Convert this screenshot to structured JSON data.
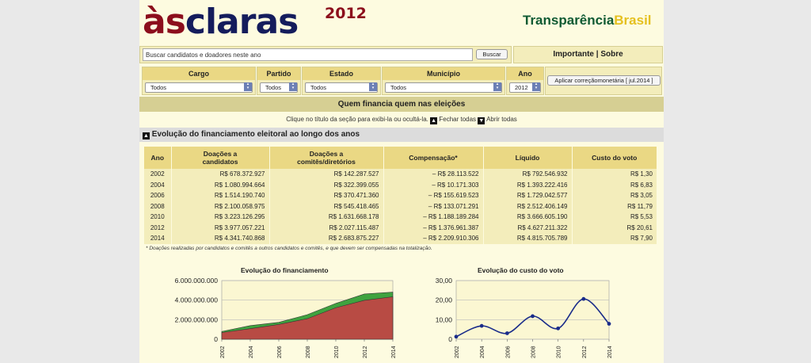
{
  "brand": {
    "part1": "às",
    "part2": "claras",
    "year": "2012"
  },
  "partner": {
    "part1": "Transparência",
    "part2": "Brasil"
  },
  "search": {
    "placeholder": "Buscar candidatos e doadores neste ano",
    "button": "Buscar"
  },
  "top_links": {
    "important": "Importante",
    "sep": " | ",
    "about": "Sobre"
  },
  "filters": [
    {
      "label": "Cargo",
      "value": "Todos"
    },
    {
      "label": "Partido",
      "value": "Todos"
    },
    {
      "label": "Estado",
      "value": "Todos"
    },
    {
      "label": "Município",
      "value": "Todos"
    },
    {
      "label": "Ano",
      "value": "2012"
    }
  ],
  "apply_button": "Aplicar correçãomonetária [ jul.2014 ]",
  "section_header": "Quem financia quem nas eleições",
  "hint": {
    "text": "Clique no título da seção para exibi-la ou ocultá-la.",
    "close_all": "Fechar todas",
    "open_all": "Abrir todas"
  },
  "section_title": "Evolução do financiamento eleitoral ao longo dos anos",
  "table": {
    "headers": [
      "Ano",
      "Doações a\ncandidatos",
      "Doações a\ncomitês/diretórios",
      "Compensação*",
      "Líquido",
      "Custo do voto"
    ],
    "rows": [
      [
        "2002",
        "R$ 678.372.927",
        "R$ 142.287.527",
        "– R$ 28.113.522",
        "R$ 792.546.932",
        "R$ 1,30"
      ],
      [
        "2004",
        "R$ 1.080.994.664",
        "R$ 322.399.055",
        "– R$ 10.171.303",
        "R$ 1.393.222.416",
        "R$ 6,83"
      ],
      [
        "2006",
        "R$ 1.514.190.740",
        "R$ 370.471.360",
        "– R$ 155.619.523",
        "R$ 1.729.042.577",
        "R$ 3,05"
      ],
      [
        "2008",
        "R$ 2.100.058.975",
        "R$ 545.418.465",
        "– R$ 133.071.291",
        "R$ 2.512.406.149",
        "R$ 11,79"
      ],
      [
        "2010",
        "R$ 3.223.126.295",
        "R$ 1.631.668.178",
        "– R$ 1.188.189.284",
        "R$ 3.666.605.190",
        "R$ 5,53"
      ],
      [
        "2012",
        "R$ 3.977.057.221",
        "R$ 2.027.115.487",
        "– R$ 1.376.961.387",
        "R$ 4.627.211.322",
        "R$ 20,61"
      ],
      [
        "2014",
        "R$ 4.341.740.868",
        "R$ 2.683.875.227",
        "– R$ 2.209.910.306",
        "R$ 4.815.705.789",
        "R$ 7,90"
      ]
    ]
  },
  "note": "* Doações realizadas por candidatos e comitês a outros candidatos e comitês, e que devem ser compensadas na totalização.",
  "colors": {
    "cream": "#fdfbe0",
    "header_gold": "#ead884",
    "logo_red": "#8c0e1c",
    "logo_navy": "#141c5c",
    "area_red": "#b84b44",
    "area_green": "#3fa33f",
    "line_blue": "#1a2c8a"
  },
  "chart_data": [
    {
      "type": "area",
      "title": "Evolução do financiamento",
      "x": [
        "2002",
        "2004",
        "2006",
        "2008",
        "2010",
        "2012",
        "2014"
      ],
      "ylim": [
        0,
        6000000000
      ],
      "yticks": [
        "0",
        "2.000.000.000",
        "4.000.000.000",
        "6.000.000.000"
      ],
      "series": [
        {
          "values": [
            678372927,
            1080994664,
            1514190740,
            2100058975,
            3223126295,
            3977057221,
            4341740868
          ],
          "color": "#b84b44"
        },
        {
          "values": [
            792546932,
            1393222416,
            1729042577,
            2512406149,
            3666605190,
            4627211322,
            4815705789
          ],
          "color": "#3fa33f"
        }
      ],
      "grid": true
    },
    {
      "type": "line",
      "title": "Evolução do custo do voto",
      "x": [
        "2002",
        "2004",
        "2006",
        "2008",
        "2010",
        "2012",
        "2014"
      ],
      "ylim": [
        0,
        30
      ],
      "yticks": [
        "0",
        "10,00",
        "20,00",
        "30,00"
      ],
      "series": [
        {
          "values": [
            1.3,
            6.83,
            3.05,
            11.79,
            5.53,
            20.61,
            7.9
          ],
          "color": "#1a2c8a"
        }
      ],
      "grid": true
    }
  ]
}
